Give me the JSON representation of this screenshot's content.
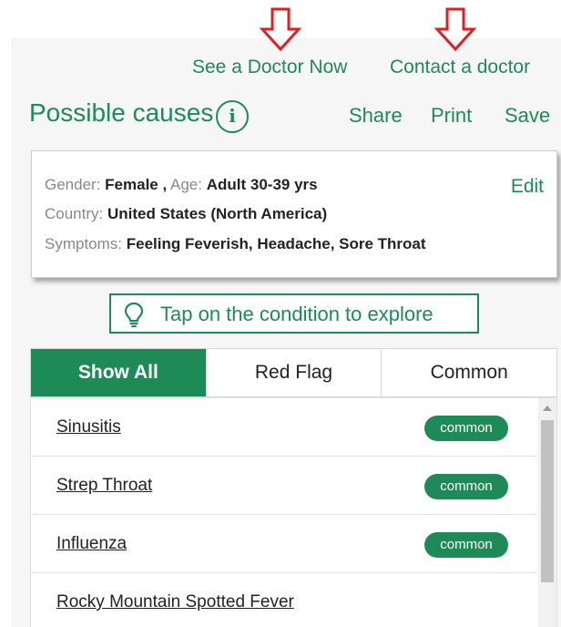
{
  "header": {
    "see_doctor": "See a Doctor Now",
    "contact_doctor": "Contact a doctor"
  },
  "title": "Possible causes",
  "actions": {
    "share": "Share",
    "print": "Print",
    "save": "Save"
  },
  "summary": {
    "gender_label": "Gender:",
    "gender_value": "Female ,",
    "age_label": "Age:",
    "age_value": "Adult 30-39 yrs",
    "country_label": "Country:",
    "country_value": "United States (North America)",
    "symptoms_label": "Symptoms:",
    "symptoms_value": "Feeling Feverish, Headache, Sore Throat",
    "edit": "Edit"
  },
  "hint": "Tap on the condition to explore",
  "tabs": [
    {
      "label": "Show All",
      "active": true
    },
    {
      "label": "Red Flag",
      "active": false
    },
    {
      "label": "Common",
      "active": false
    }
  ],
  "conditions": [
    {
      "name": "Sinusitis",
      "badge": "common"
    },
    {
      "name": "Strep Throat",
      "badge": "common"
    },
    {
      "name": "Influenza",
      "badge": "common"
    },
    {
      "name": "Rocky Mountain Spotted Fever",
      "badge": ""
    }
  ],
  "colors": {
    "brand_green": "#1e8a58",
    "annotation_arrow": "#e02020"
  }
}
